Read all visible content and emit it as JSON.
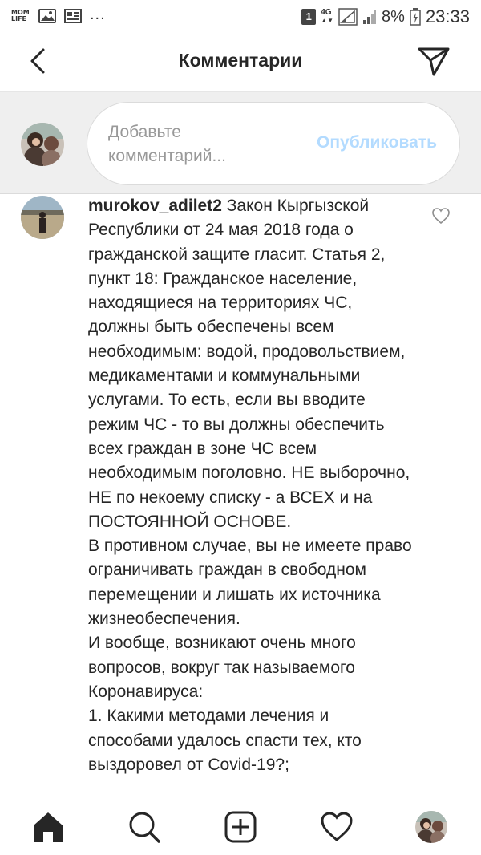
{
  "status_bar": {
    "app_logo_text": "MOM LIFE",
    "notification_icons": [
      "gallery-icon",
      "news-icon"
    ],
    "more_notifications": "...",
    "sim_slot": "1",
    "network_type": "4G",
    "battery_percent": "8%",
    "time": "23:33"
  },
  "header": {
    "title": "Комментарии",
    "back_icon": "chevron-left-icon",
    "share_icon": "direct-share-icon"
  },
  "composer": {
    "placeholder": "Добавьте комментарий...",
    "publish_label": "Опубликовать",
    "publish_color": "#b3dbff"
  },
  "comment": {
    "username": "murokov_adilet2",
    "text": " Закон Кыргызской Республики от 24 мая 2018 года о гражданской защите гласит. Статья 2, пункт 18: Гражданское население, находящиеся на территориях ЧС, должны быть обеспечены всем необходимым: водой, продовольствием, медикаментами и коммунальными услугами. То есть, если вы вводите режим ЧС - то вы должны обеспечить всех граждан в зоне ЧС всем необходимым поголовно. НЕ выборочно, НЕ по некоему списку - а ВСЕХ и на ПОСТОЯННОЙ ОСНОВЕ.\nВ противном случае, вы не имеете право ограничивать граждан в свободном перемещении и лишать их источника жизнеобеспечения.\nИ вообще, возникают очень много вопросов, вокруг так называемого Коронавируса:\n1. Какими методами лечения и способами удалось спасти тех, кто выздоровел от Covid-19?;",
    "like_icon": "heart-outline-icon"
  },
  "bottom_nav": {
    "items": [
      "home-icon",
      "search-icon",
      "new-post-icon",
      "activity-heart-icon",
      "profile-avatar"
    ]
  }
}
